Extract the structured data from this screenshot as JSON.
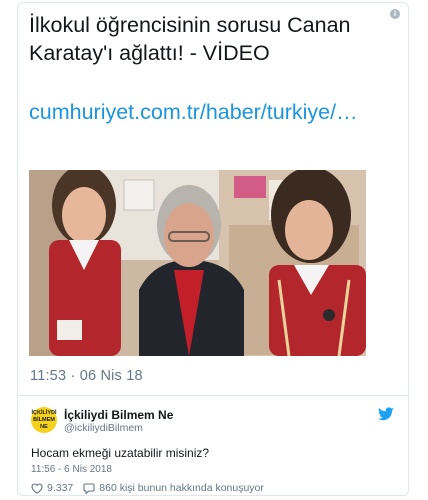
{
  "tweet": {
    "headline": "İlkokul öğrencisinin sorusu Canan Karatay'ı ağlattı! - VİDEO",
    "link_text": "cumhuriyet.com.tr/haber/turkiye/…",
    "timestamp": "11:53 · 06 Nis 18",
    "info_glyph": "i"
  },
  "quoted": {
    "avatar_text": "İÇKİLİYDİ BİLMEM NE",
    "name": "İçkiliydi Bilmem Ne",
    "handle": "@ickiliydiBilmem",
    "text": "Hocam ekmeği uzatabilir misiniz?",
    "date": "11:56 - 6 Nis 2018",
    "likes": "9.337",
    "talking": "860 kişi bunun hakkında konuşuyor"
  },
  "icons": {
    "info": "info-icon",
    "bird": "twitter-bird-icon",
    "heart": "heart-icon",
    "comment": "comment-icon"
  },
  "colors": {
    "link": "#1b95e0",
    "muted": "#657786",
    "text": "#14171a",
    "avatar_bg": "#f6d21c"
  }
}
